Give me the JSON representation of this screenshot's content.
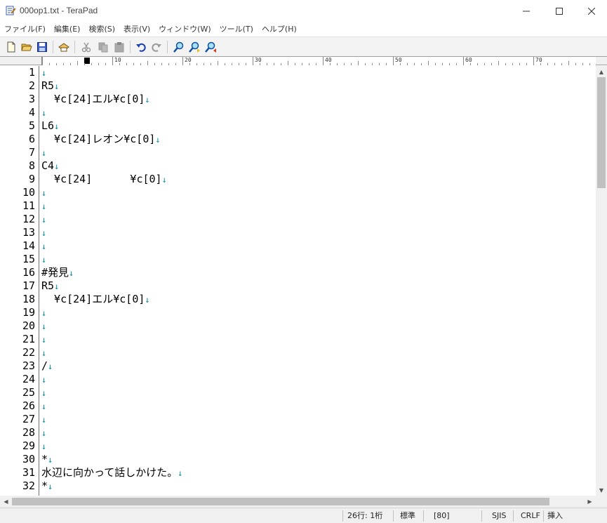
{
  "window": {
    "title": "000op1.txt - TeraPad"
  },
  "menu": [
    "ファイル(F)",
    "編集(E)",
    "検索(S)",
    "表示(V)",
    "ウィンドウ(W)",
    "ツール(T)",
    "ヘルプ(H)"
  ],
  "toolbar_icons": [
    "new-file-icon",
    "open-folder-icon",
    "save-icon",
    "print-icon",
    "cut-icon",
    "copy-icon",
    "paste-icon",
    "undo-icon",
    "redo-icon",
    "find-icon",
    "find-next-icon",
    "find-prev-icon"
  ],
  "ruler": {
    "marks": [
      "0",
      "10",
      "20",
      "30",
      "40",
      "50",
      "60",
      "70"
    ]
  },
  "editor": {
    "newline_mark": "↓",
    "lines": [
      {
        "no": "1",
        "text": ""
      },
      {
        "no": "2",
        "text": "R5"
      },
      {
        "no": "3",
        "text": "  ¥c[24]エル¥c[0]"
      },
      {
        "no": "4",
        "text": ""
      },
      {
        "no": "5",
        "text": "L6"
      },
      {
        "no": "6",
        "text": "  ¥c[24]レオン¥c[0]"
      },
      {
        "no": "7",
        "text": ""
      },
      {
        "no": "8",
        "text": "C4"
      },
      {
        "no": "9",
        "text": "  ¥c[24]      ¥c[0]"
      },
      {
        "no": "10",
        "text": ""
      },
      {
        "no": "11",
        "text": ""
      },
      {
        "no": "12",
        "text": ""
      },
      {
        "no": "13",
        "text": ""
      },
      {
        "no": "14",
        "text": ""
      },
      {
        "no": "15",
        "text": ""
      },
      {
        "no": "16",
        "text": "#発見"
      },
      {
        "no": "17",
        "text": "R5"
      },
      {
        "no": "18",
        "text": "  ¥c[24]エル¥c[0]"
      },
      {
        "no": "19",
        "text": ""
      },
      {
        "no": "20",
        "text": ""
      },
      {
        "no": "21",
        "text": ""
      },
      {
        "no": "22",
        "text": ""
      },
      {
        "no": "23",
        "text": "/"
      },
      {
        "no": "24",
        "text": ""
      },
      {
        "no": "25",
        "text": ""
      },
      {
        "no": "26",
        "text": ""
      },
      {
        "no": "27",
        "text": ""
      },
      {
        "no": "28",
        "text": ""
      },
      {
        "no": "29",
        "text": ""
      },
      {
        "no": "30",
        "text": "*"
      },
      {
        "no": "31",
        "text": "水辺に向かって話しかけた。"
      },
      {
        "no": "32",
        "text": "*"
      }
    ]
  },
  "status": {
    "position": "26行:  1桁",
    "mode": "標準",
    "wrap": "[80]",
    "encoding": "SJIS",
    "newline": "CRLF",
    "insert": "挿入"
  },
  "colors": {
    "newline_mark": "#0a8aa0",
    "toolbar_bg": "#f3f3f3"
  }
}
